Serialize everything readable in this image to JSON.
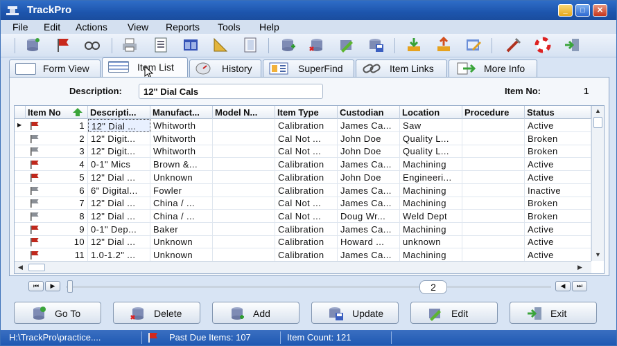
{
  "window": {
    "title": "TrackPro"
  },
  "menu": [
    "File",
    "Edit",
    "Actions",
    "View",
    "Reports",
    "Tools",
    "Help"
  ],
  "tabs": [
    {
      "label": "Form View",
      "icon": "form-icon"
    },
    {
      "label": "Item List",
      "icon": "list-icon",
      "active": true
    },
    {
      "label": "History",
      "icon": "history-icon"
    },
    {
      "label": "SuperFind",
      "icon": "superfind-icon"
    },
    {
      "label": "Item Links",
      "icon": "link-icon"
    },
    {
      "label": "More Info",
      "icon": "more-info-icon"
    }
  ],
  "form": {
    "description_label": "Description:",
    "description_value": "12\" Dial Cals",
    "item_no_label": "Item No:",
    "item_no_value": "1"
  },
  "grid": {
    "columns": [
      "Item No",
      "Descripti...",
      "Manufact...",
      "Model N...",
      "Item Type",
      "Custodian",
      "Location",
      "Procedure",
      "Status"
    ],
    "rows": [
      {
        "flag": "red",
        "item_no": "1",
        "description": "12\" Dial ...",
        "manufacturer": "Whitworth",
        "model": "",
        "item_type": "Calibration",
        "custodian": "James Ca...",
        "location": "Saw",
        "procedure": "",
        "status": "Active"
      },
      {
        "flag": "gray",
        "item_no": "2",
        "description": "12\" Digit...",
        "manufacturer": "Whitworth",
        "model": "",
        "item_type": "Cal Not ...",
        "custodian": "John Doe",
        "location": "Quality L...",
        "procedure": "",
        "status": "Broken"
      },
      {
        "flag": "gray",
        "item_no": "3",
        "description": "12\" Digit...",
        "manufacturer": "Whitworth",
        "model": "",
        "item_type": "Cal Not ...",
        "custodian": "John Doe",
        "location": "Quality L...",
        "procedure": "",
        "status": "Broken"
      },
      {
        "flag": "red",
        "item_no": "4",
        "description": "0-1\" Mics",
        "manufacturer": "Brown &...",
        "model": "",
        "item_type": "Calibration",
        "custodian": "James Ca...",
        "location": "Machining",
        "procedure": "",
        "status": "Active"
      },
      {
        "flag": "red",
        "item_no": "5",
        "description": "12\" Dial ...",
        "manufacturer": "Unknown",
        "model": "",
        "item_type": "Calibration",
        "custodian": "John Doe",
        "location": "Engineeri...",
        "procedure": "",
        "status": "Active"
      },
      {
        "flag": "gray",
        "item_no": "6",
        "description": "6\" Digital...",
        "manufacturer": "Fowler",
        "model": "",
        "item_type": "Calibration",
        "custodian": "James Ca...",
        "location": "Machining",
        "procedure": "",
        "status": "Inactive"
      },
      {
        "flag": "gray",
        "item_no": "7",
        "description": "12\" Dial ...",
        "manufacturer": "China / ...",
        "model": "",
        "item_type": "Cal Not ...",
        "custodian": "James Ca...",
        "location": "Machining",
        "procedure": "",
        "status": "Broken"
      },
      {
        "flag": "gray",
        "item_no": "8",
        "description": "12\" Dial ...",
        "manufacturer": "China / ...",
        "model": "",
        "item_type": "Cal Not ...",
        "custodian": "Doug Wr...",
        "location": "Weld Dept",
        "procedure": "",
        "status": "Broken"
      },
      {
        "flag": "red",
        "item_no": "9",
        "description": "0-1\" Dep...",
        "manufacturer": "Baker",
        "model": "",
        "item_type": "Calibration",
        "custodian": "James Ca...",
        "location": "Machining",
        "procedure": "",
        "status": "Active"
      },
      {
        "flag": "red",
        "item_no": "10",
        "description": "12\" Dial ...",
        "manufacturer": "Unknown",
        "model": "",
        "item_type": "Calibration",
        "custodian": "Howard ...",
        "location": "unknown",
        "procedure": "",
        "status": "Active"
      },
      {
        "flag": "red",
        "item_no": "11",
        "description": "1.0-1.2\" ...",
        "manufacturer": "Unknown",
        "model": "",
        "item_type": "Calibration",
        "custodian": "James Ca...",
        "location": "Machining",
        "procedure": "",
        "status": "Active"
      }
    ]
  },
  "navigator": {
    "page": "2"
  },
  "actions": [
    {
      "label": "Go To",
      "icon": "goto-icon"
    },
    {
      "label": "Delete",
      "icon": "delete-icon"
    },
    {
      "label": "Add",
      "icon": "add-icon"
    },
    {
      "label": "Update",
      "icon": "update-icon"
    },
    {
      "label": "Edit",
      "icon": "edit-icon"
    },
    {
      "label": "Exit",
      "icon": "exit-icon"
    }
  ],
  "status": {
    "path": "H:\\TrackPro\\practice....",
    "past_due": "Past Due Items: 107",
    "item_count": "Item Count: 121"
  },
  "colors": {
    "flag_red": "#c0281c",
    "flag_gray": "#8a8f96",
    "title_blue": "#1d55ad"
  }
}
